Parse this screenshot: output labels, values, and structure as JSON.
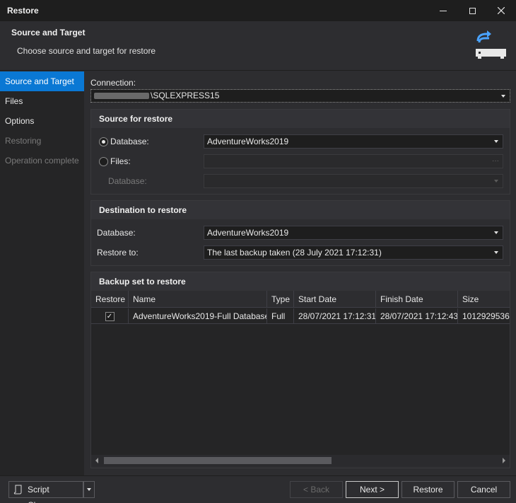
{
  "window": {
    "title": "Restore"
  },
  "header": {
    "title": "Source and Target",
    "subtitle": "Choose source and target for restore"
  },
  "sidebar": {
    "items": [
      {
        "label": "Source and Target"
      },
      {
        "label": "Files"
      },
      {
        "label": "Options"
      },
      {
        "label": "Restoring"
      },
      {
        "label": "Operation complete"
      }
    ]
  },
  "connection": {
    "label": "Connection:",
    "value": "\\SQLEXPRESS15"
  },
  "source": {
    "title": "Source for restore",
    "database_label": "Database:",
    "database_value": "AdventureWorks2019",
    "files_label": "Files:",
    "files_value": "",
    "sub_database_label": "Database:",
    "sub_database_value": "",
    "browse": "···"
  },
  "destination": {
    "title": "Destination to restore",
    "database_label": "Database:",
    "database_value": "AdventureWorks2019",
    "restore_to_label": "Restore to:",
    "restore_to_value": "The last backup taken (28 July 2021 17:12:31)"
  },
  "backup": {
    "title": "Backup set to restore",
    "columns": [
      "Restore",
      "Name",
      "Type",
      "Start Date",
      "Finish Date",
      "Size"
    ],
    "rows": [
      {
        "restore": "✓",
        "name": "AdventureWorks2019-Full Database...",
        "type": "Full",
        "start": "28/07/2021 17:12:31",
        "finish": "28/07/2021 17:12:43",
        "size": "1012929536"
      }
    ]
  },
  "footer": {
    "script_changes": "Script Changes",
    "back": "< Back",
    "next": "Next >",
    "restore": "Restore",
    "cancel": "Cancel"
  }
}
